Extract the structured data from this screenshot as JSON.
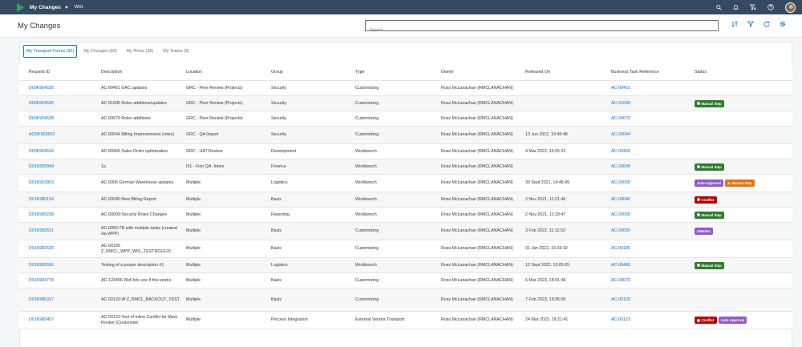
{
  "shell": {
    "app_title": "My Changes",
    "system": "W01"
  },
  "header": {
    "title": "My Changes",
    "search_placeholder": "Search"
  },
  "tabs": [
    {
      "label": "My Transport Forms (92)",
      "active": true
    },
    {
      "label": "My Changes (83)",
      "active": false
    },
    {
      "label": "My Roles (38)",
      "active": false
    },
    {
      "label": "My Teams (8)",
      "active": false
    }
  ],
  "columns": [
    "Request ID",
    "Description",
    "Location",
    "Group",
    "Type",
    "Owner",
    "Released On",
    "Business Task Reference",
    "Status"
  ],
  "rows": [
    {
      "id": "D00K904530",
      "desc": "AC-00451 GRC updates",
      "loc": "GRC - Peer Review (Projects)",
      "group": "Security",
      "type": "Customizing",
      "owner": "Ross McLanachan (RMCLANACHAN)",
      "released": "",
      "ref": "AC-00451",
      "status": []
    },
    {
      "id": "D00K904536",
      "desc": "AC-01006 Roles additions/updates",
      "loc": "GRC - Peer Review (Projects)",
      "group": "Security",
      "type": "Customizing",
      "owner": "Ross McLanachan (RMCLANACHAN)",
      "released": "",
      "ref": "AC-01006",
      "status": [
        "Manual Step"
      ]
    },
    {
      "id": "D00K904538",
      "desc": "AC-00670 Roles additions",
      "loc": "GRC - Peer Review (Projects)",
      "group": "Security",
      "type": "Customizing",
      "owner": "Ross McLanachan (RMCLANACHAN)",
      "released": "",
      "ref": "AC-00670",
      "status": []
    },
    {
      "id": "ACDK903652",
      "desc": "AC-00044 Billing Improvements (roles)",
      "loc": "GRC - QA Import",
      "group": "Security",
      "type": "Customizing",
      "owner": "Ross McLanachan (RMCLANACHAN)",
      "released": "13 Jun 2022, 19:45:48",
      "ref": "AC-00044",
      "status": []
    },
    {
      "id": "D00K904534",
      "desc": "AC-00469 Sales Order optimisation",
      "loc": "GRC - UAT Review",
      "group": "Development",
      "type": "Workbench",
      "owner": "Ross McLanachan (RMCLANACHAN)",
      "released": "4 Mar 2022, 15:55:31",
      "ref": "AC-00469",
      "status": []
    },
    {
      "id": "D01K983949",
      "desc": "1a",
      "loc": "I01 - Fiori QA: Inbox",
      "group": "Finance",
      "type": "Workbench",
      "owner": "Ross McLanachan (RMCLANACHAN)",
      "released": "",
      "ref": "AC-00009",
      "status": [
        "Manual Step"
      ]
    },
    {
      "id": "D01K963803",
      "desc": "AC-0006 German Warehouse updates",
      "loc": "Multiple",
      "group": "Logistics",
      "type": "Workbench",
      "owner": "Ross McLanachan (RMCLANACHAN)",
      "released": "30 Sept 2021, 14:45:49",
      "ref": "AC-00009",
      "status": [
        "Auto-Approval",
        "Manual Step (warning)"
      ]
    },
    {
      "id": "D01K980159",
      "desc": "AC-00045:New Billing Report",
      "loc": "Multiple",
      "group": "Basis",
      "type": "Workbench",
      "owner": "Ross McLanachan (RMCLANACHAN)",
      "released": "2 Nov 2021, 11:21:46",
      "ref": "AC-00045",
      "status": [
        "Conflict"
      ]
    },
    {
      "id": "D01K980238",
      "desc": "AC-00009:Security Roles Changes",
      "loc": "Multiple",
      "group": "Reporting",
      "type": "Workbench",
      "owner": "Ross McLanachan (RMCLANACHAN)",
      "released": "2 Nov 2021, 11:19:47",
      "ref": "AC-00009",
      "status": [
        "Manual Step"
      ]
    },
    {
      "id": "D01K982621",
      "desc": "AC-0050:TR with multiple tasks (created via WPP)",
      "loc": "Multiple",
      "group": "Basis",
      "type": "Customizing",
      "owner": "Ross McLanachan (RMCLANACHAN)",
      "released": "3 Feb 2022, 11:12:52",
      "ref": "AC-00050",
      "status": [
        "UModes"
      ]
    },
    {
      "id": "D01K982630",
      "desc": "AC-00180 Z_RMCL_WPP_W01_TESTROLE20",
      "loc": "Multiple",
      "group": "Basis",
      "type": "Customizing",
      "owner": "Ross McLanachan (RMCLANACHAN)",
      "released": "31 Jan 2022, 16:33:10",
      "ref": "AC-00180",
      "status": []
    },
    {
      "id": "D01K982656",
      "desc": "Testing of a proper description #1",
      "loc": "Multiple",
      "group": "Logistics",
      "type": "Workbench",
      "owner": "Ross McLanachan (RMCLANACHAN)",
      "released": "12 Sept 2022, 13:05:05",
      "ref": "AC-00465",
      "status": [
        "Manual Step"
      ]
    },
    {
      "id": "D01K983778",
      "desc": "AC-123456 Well lets see if this works",
      "loc": "Multiple",
      "group": "Basis",
      "type": "Customizing",
      "owner": "Ross McLanachan (RMCLANACHAN)",
      "released": "6 Mar 2023, 18:01:46",
      "ref": "AC-00670",
      "status": []
    },
    {
      "id": "D01K985327",
      "desc": "AC-00120:W:Z_RMCL_BACKOUT_TEST",
      "loc": "Multiple",
      "group": "Basis",
      "type": "Customizing",
      "owner": "Ross McLanachan (RMCLANACHAN)",
      "released": "7 Feb 2023, 19:35:00",
      "ref": "AC-00120",
      "status": []
    },
    {
      "id": "D01K985457",
      "desc": "AC-00123:Test of Inline Conflict for Mark Rooker (Customisin",
      "loc": "Multiple",
      "group": "Process Integration",
      "type": "External Vendor Transport",
      "owner": "Ross McLanachan (RMCLANACHAN)",
      "released": "24 Mar 2023, 16:21:41",
      "ref": "AC-00123",
      "status": [
        "Conflict",
        "Auto-Approval"
      ]
    }
  ],
  "badge_labels": {
    "manual": "Manual Step",
    "conflict": "Conflict",
    "auto": "Auto-Approval",
    "umodes": "UModes"
  },
  "colors": {
    "shell": "#354a5f",
    "link": "#0a6ed1",
    "manual": "#2b7d2b",
    "conflict": "#bb0000",
    "auto": "#925ace",
    "warning": "#e9730c"
  }
}
